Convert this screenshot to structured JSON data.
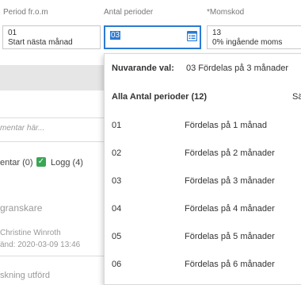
{
  "fields": {
    "period_from": {
      "label": "Period fr.o.m",
      "code": "01",
      "desc": "Start nästa månad"
    },
    "antal_perioder": {
      "label": "Antal perioder",
      "value": "03"
    },
    "momskod": {
      "label": "*Momskod",
      "code": "13",
      "desc": "0% ingående moms"
    }
  },
  "left_panel": {
    "comment_placeholder": "mentar här...",
    "tabs": {
      "comments": "entar (0)",
      "log": "Logg (4)"
    },
    "section_title": "granskare",
    "reviewer_name": "Christine Winroth",
    "reviewer_date": "änd: 2020-03-09 13:46",
    "status": "skning utförd"
  },
  "dropdown": {
    "current_label": "Nuvarande val:",
    "current_value": "03 Fördelas på 3 månader",
    "all_header": "Alla Antal perioder (12)",
    "search_label": "Sä",
    "options": [
      {
        "code": "01",
        "desc": "Fördelas på 1 månad"
      },
      {
        "code": "02",
        "desc": "Fördelas på 2 månader"
      },
      {
        "code": "03",
        "desc": "Fördelas på 3 månader"
      },
      {
        "code": "04",
        "desc": "Fördelas på 4 månader"
      },
      {
        "code": "05",
        "desc": "Fördelas på 5 månader"
      },
      {
        "code": "06",
        "desc": "Fördelas på 6 månader"
      }
    ]
  },
  "colors": {
    "accent": "#2b7bd3",
    "check": "#3aa655"
  },
  "icons": {
    "lookup": "calculator-list-icon",
    "log_check": "checkbox-checked-icon"
  }
}
